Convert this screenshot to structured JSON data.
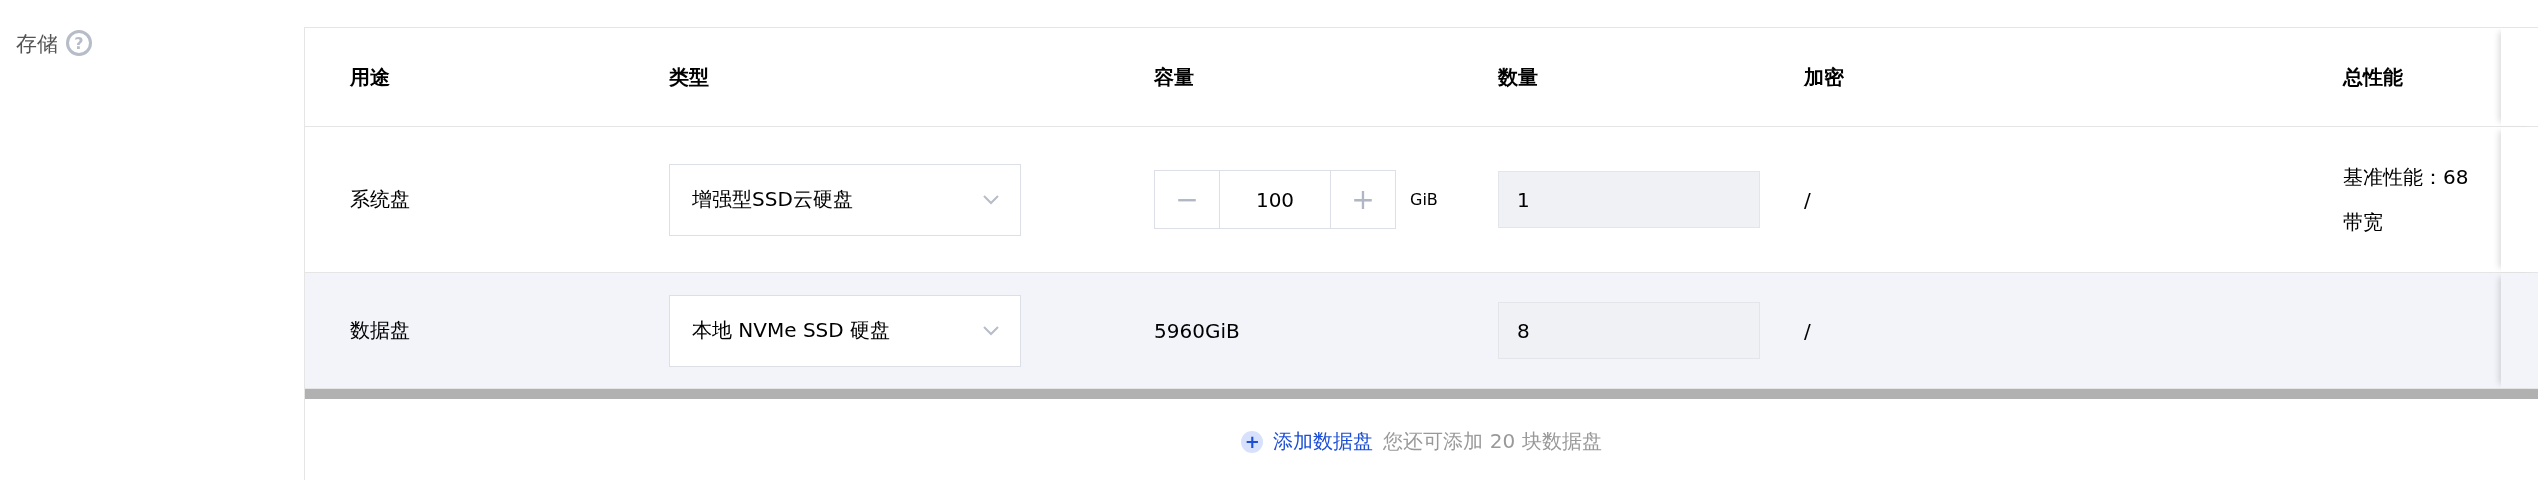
{
  "section": {
    "label": "存储",
    "help_icon": "?"
  },
  "table": {
    "columns": [
      "用途",
      "类型",
      "容量",
      "数量",
      "加密",
      "总性能"
    ],
    "rows": [
      {
        "usage": "系统盘",
        "type": "增强型SSD云硬盘",
        "kind": "stepper",
        "capacity": "100",
        "unit": "GiB",
        "minus": "−",
        "plus": "+",
        "quantity": "1",
        "encryption": "/",
        "performance": [
          "基准性能：68",
          "带宽"
        ],
        "highlighted": false
      },
      {
        "usage": "数据盘",
        "type": "本地 NVMe SSD 硬盘",
        "kind": "text",
        "capacity": "5960GiB",
        "quantity": "8",
        "encryption": "/",
        "highlighted": true
      }
    ]
  },
  "add": {
    "icon": "+",
    "link": "添加数据盘",
    "hint": "您还可添加 20 块数据盘"
  }
}
